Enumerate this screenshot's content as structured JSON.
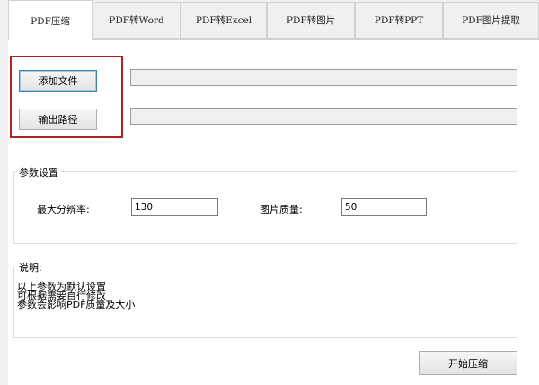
{
  "tabs": [
    {
      "label": "PDF压缩",
      "active": true
    },
    {
      "label": "PDF转Word",
      "active": false
    },
    {
      "label": "PDF转Excel",
      "active": false
    },
    {
      "label": "PDF转图片",
      "active": false
    },
    {
      "label": "PDF转PPT",
      "active": false
    },
    {
      "label": "PDF图片提取",
      "active": false
    }
  ],
  "files": {
    "add_file_label": "添加文件",
    "output_path_label": "输出路径",
    "input_path_value": "",
    "output_path_value": ""
  },
  "params": {
    "title": "参数设置",
    "max_resolution_label": "最大分辨率:",
    "max_resolution_value": "130",
    "image_quality_label": "图片质量:",
    "image_quality_value": "50"
  },
  "description": {
    "title": "说明:",
    "lines": [
      "以上参数为默认设置",
      "可根据需要自行修改",
      "参数会影响PDF质量及大小"
    ]
  },
  "actions": {
    "start_label": "开始压缩"
  },
  "colors": {
    "highlight": "#b22222",
    "focus_border": "#3c7fb1"
  }
}
